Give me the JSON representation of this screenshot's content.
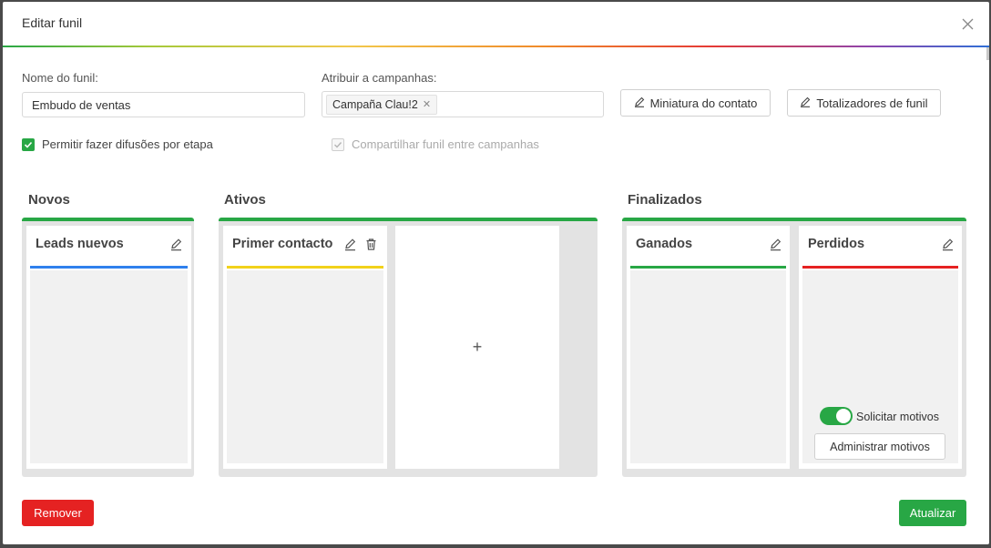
{
  "modal": {
    "title": "Editar funil"
  },
  "form": {
    "funnel_name_label": "Nome do funil",
    "funnel_name_value": "Embudo de ventas",
    "campaigns_label": "Atribuir a campanhas",
    "campaign_tag": "Campaña Clau!2",
    "contact_thumb_button": "Miniatura do contato",
    "totalizers_button": "Totalizadores de funil",
    "allow_broadcast_label": "Permitir fazer difusões por etapa",
    "allow_broadcast_checked": true,
    "share_funnel_label": "Compartilhar funil entre campanhas",
    "share_funnel_checked": true,
    "share_funnel_disabled": true
  },
  "groups": {
    "new": {
      "title": "Novos"
    },
    "active": {
      "title": "Ativos"
    },
    "closed": {
      "title": "Finalizados"
    }
  },
  "stages": {
    "leads_nuevos": {
      "name": "Leads nuevos",
      "color": "#2f80ed"
    },
    "primer_contacto": {
      "name": "Primer contacto",
      "color": "#f2d21b"
    },
    "ganados": {
      "name": "Ganados",
      "color": "#28a745"
    },
    "perdidos": {
      "name": "Perdidos",
      "color": "#e52222"
    }
  },
  "add_stage": {
    "symbol": "+"
  },
  "lost_reasons": {
    "toggle_label": "Solicitar motivos",
    "toggle_on": true,
    "manage_button": "Administrar motivos"
  },
  "footer": {
    "remove_button": "Remover",
    "update_button": "Atualizar"
  },
  "colors": {
    "group_accent": "#28a745",
    "danger": "#e52222",
    "success": "#28a745"
  },
  "icons": {
    "close": "close-icon",
    "edit": "pencil-icon",
    "delete": "trash-icon",
    "check": "check-icon"
  }
}
